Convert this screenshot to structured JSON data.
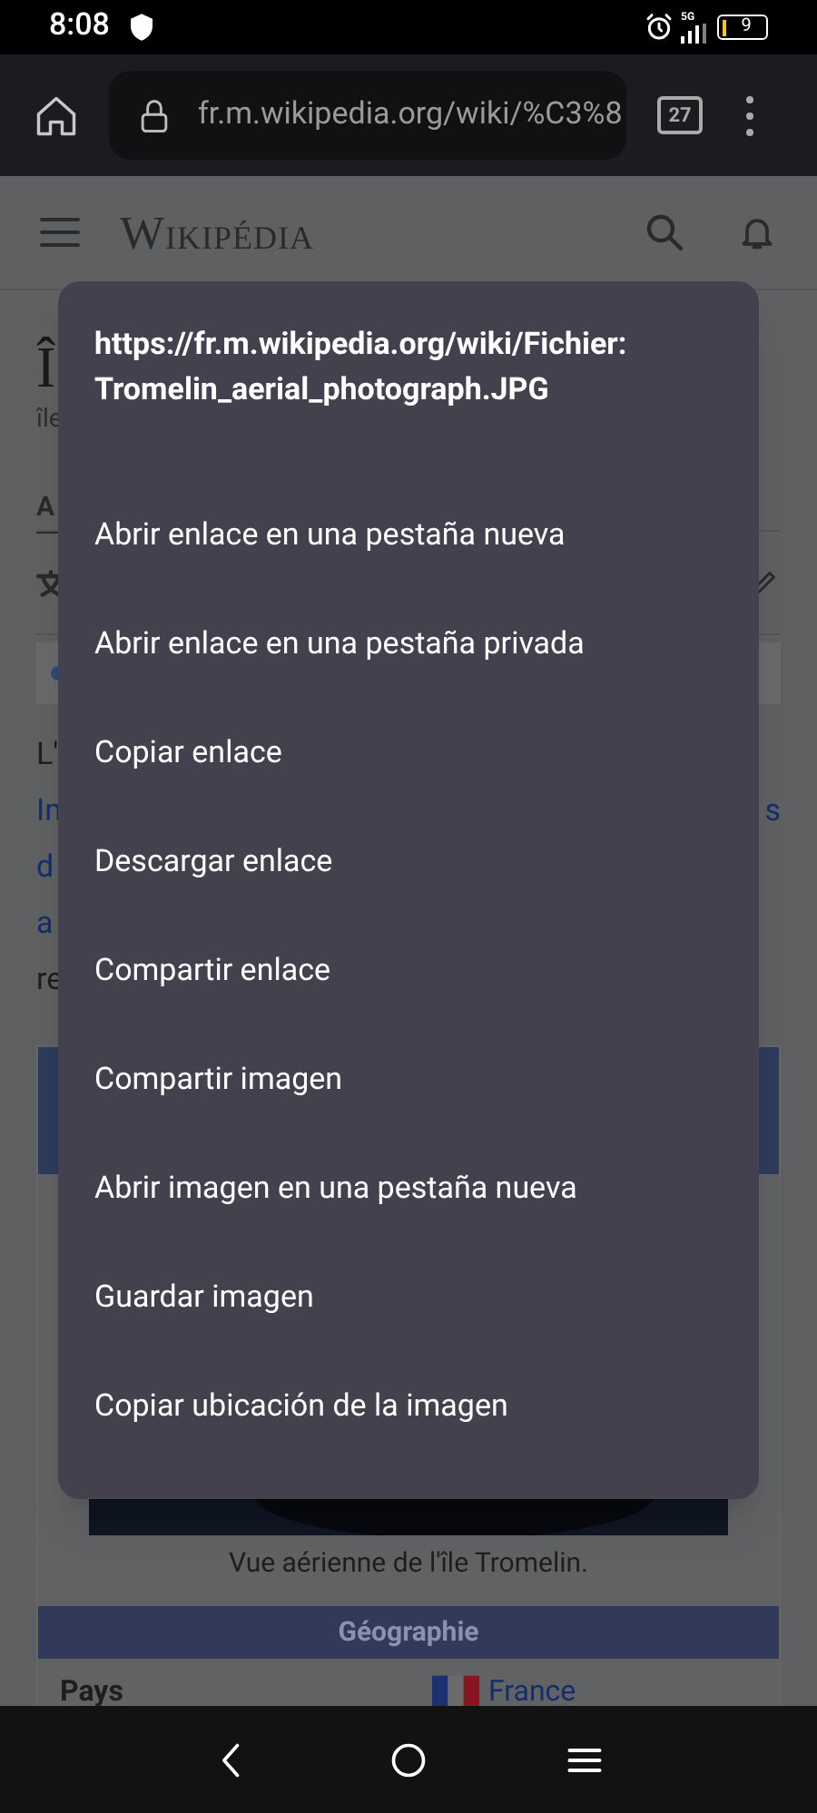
{
  "status_bar": {
    "time": "8:08",
    "network": "5G",
    "battery": "9"
  },
  "browser": {
    "url": "fr.m.wikipedia.org/wiki/%C3%8",
    "tab_count": "27"
  },
  "site_header": {
    "logo": "Wikipédia"
  },
  "article": {
    "title": "Î",
    "subtitle": "île",
    "tab": "A",
    "lines": [
      {
        "text": "L'",
        "link": false
      },
      {
        "text": "In",
        "link": true,
        "right": "s"
      },
      {
        "text": "d",
        "link": true
      },
      {
        "text": "a",
        "link": true
      },
      {
        "text": "re",
        "link": false
      }
    ],
    "infobox": {
      "caption": "Vue aérienne de l'île Tromelin.",
      "section": "Géographie",
      "rows": [
        {
          "label": "Pays",
          "value": "France"
        }
      ]
    }
  },
  "context_menu": {
    "url": "https://fr.m.wikipedia.org/wiki/Fichier:Tromelin_aerial_photograph.JPG",
    "items": [
      "Abrir enlace en una pestaña nueva",
      "Abrir enlace en una pestaña privada",
      "Copiar enlace",
      "Descargar enlace",
      "Compartir enlace",
      "Compartir imagen",
      "Abrir imagen en una pestaña nueva",
      "Guardar imagen",
      "Copiar ubicación de la imagen"
    ]
  }
}
